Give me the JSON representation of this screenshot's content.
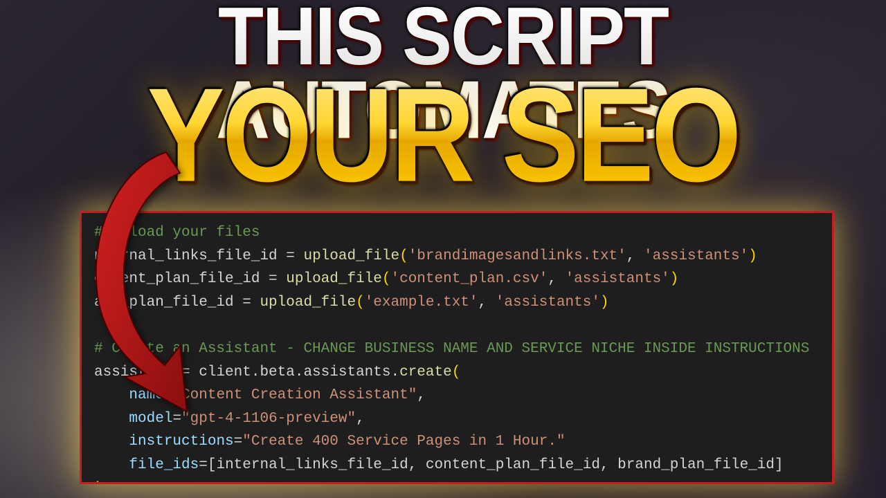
{
  "headline": {
    "line1": "THIS SCRIPT AUTOMATES",
    "line2": "YOUR SEO"
  },
  "code": {
    "comment1": "# Upload your files",
    "l1_var": "nternal_links_file_id",
    "l1_func": "upload_file",
    "l1_arg1": "'brandimagesandlinks.txt'",
    "l1_arg2": "'assistants'",
    "l2_var": "ontent_plan_file_id",
    "l2_func": "upload_file",
    "l2_arg1": "'content_plan.csv'",
    "l2_arg2": "'assistants'",
    "l3_var": "and_plan_file_id",
    "l3_func": "upload_file",
    "l3_arg1": "'example.txt'",
    "l3_arg2": "'assistants'",
    "comment2": "# Create an Assistant - CHANGE BUSINESS NAME AND SERVICE NICHE INSIDE INSTRUCTIONS",
    "l4_var": "assistant",
    "l4_expr": "client.beta.assistants.",
    "l4_func": "create",
    "kw_name": "name",
    "val_name": "\"Content Creation Assistant\"",
    "kw_model": "model",
    "val_model": "\"gpt-4-1106-preview\"",
    "kw_instructions": "instructions",
    "val_instructions": "\"Create 400 Service Pages in 1 Hour.\"",
    "kw_file_ids": "file_ids",
    "val_file_ids": "[internal_links_file_id, content_plan_file_id, brand_plan_file_id]"
  }
}
